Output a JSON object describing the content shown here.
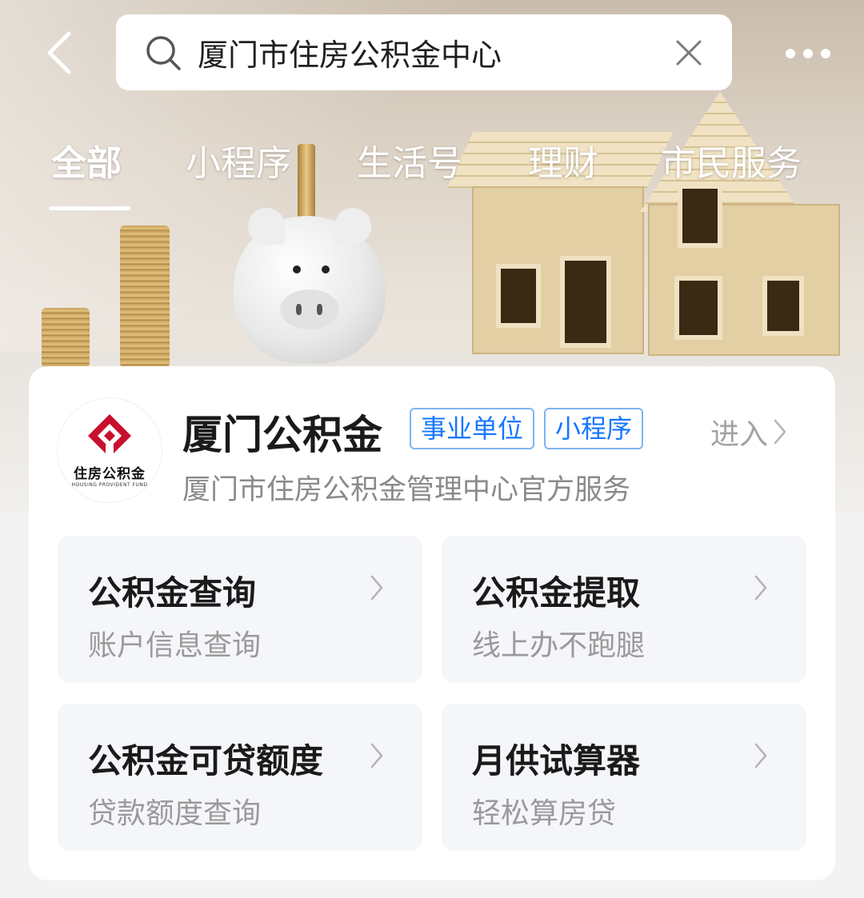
{
  "search": {
    "query": "厦门市住房公积金中心"
  },
  "tabs": [
    {
      "label": "全部",
      "active": true
    },
    {
      "label": "小程序",
      "active": false
    },
    {
      "label": "生活号",
      "active": false
    },
    {
      "label": "理财",
      "active": false
    },
    {
      "label": "市民服务",
      "active": false
    }
  ],
  "result": {
    "logo": {
      "text_cn": "住房公积金",
      "text_en": "HOUSING PROVIDENT FUND",
      "color": "#c8102e"
    },
    "name": "厦门公积金",
    "tags": [
      "事业单位",
      "小程序"
    ],
    "enter_label": "进入",
    "subtitle": "厦门市住房公积金管理中心官方服务",
    "services": [
      {
        "title": "公积金查询",
        "desc": "账户信息查询"
      },
      {
        "title": "公积金提取",
        "desc": "线上办不跑腿"
      },
      {
        "title": "公积金可贷额度",
        "desc": "贷款额度查询"
      },
      {
        "title": "月供试算器",
        "desc": "轻松算房贷"
      }
    ]
  },
  "icons": {
    "back": "chevron-left-icon",
    "search": "search-icon",
    "clear": "close-icon",
    "more": "more-dots-icon",
    "service_arrow": "chevron-right-icon"
  },
  "colors": {
    "accent_blue": "#1677ff",
    "tag_border": "#7fb4ef",
    "card_bg": "#ffffff",
    "service_bg": "#f4f6fa"
  }
}
